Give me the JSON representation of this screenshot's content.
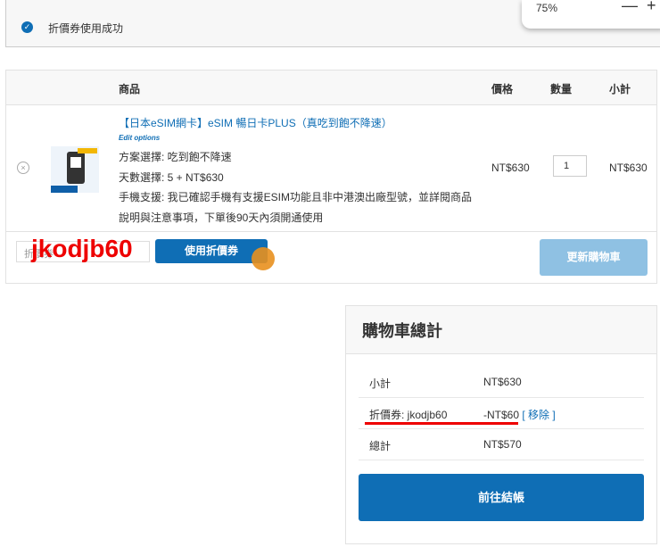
{
  "notice": {
    "text": "折價券使用成功"
  },
  "zoom": {
    "value": "75%",
    "minus": "—",
    "plus": "+"
  },
  "cart": {
    "headers": {
      "product": "商品",
      "price": "價格",
      "qty": "數量",
      "subtotal": "小計"
    },
    "item": {
      "name": "【日本eSIM網卡】eSIM 暢日卡PLUS（真吃到飽不降速）",
      "edit": "Edit options",
      "plan": "方案選擇: 吃到飽不降速",
      "days": "天數選擇: 5 + NT$630",
      "support1": "手機支援: 我已確認手機有支援ESIM功能且非中港澳出廠型號，並詳閱商品",
      "support2": "說明與注意事項，下單後90天內須開通使用",
      "price": "NT$630",
      "qty": "1",
      "subtotal": "NT$630",
      "remove": "×"
    },
    "coupon_placeholder": "折價券",
    "coupon_code_overlay": "jkodjb60",
    "apply_label": "使用折價券",
    "update_label": "更新購物車"
  },
  "totals": {
    "title": "購物車總計",
    "rows": [
      {
        "label": "小計",
        "value": "NT$630"
      },
      {
        "label": "折價券: jkodjb60",
        "value": "-NT$60",
        "link": "[ 移除 ]"
      },
      {
        "label": "總計",
        "value": "NT$570"
      }
    ],
    "checkout_label": "前往結帳"
  }
}
